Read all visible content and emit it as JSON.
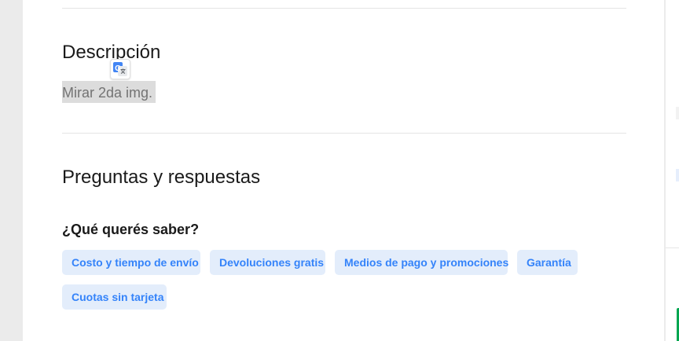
{
  "description": {
    "title": "Descripción",
    "body": "Mirar 2da img.",
    "translate_badge_letter": "G"
  },
  "qa": {
    "title": "Preguntas y respuestas",
    "prompt": "¿Qué querés saber?",
    "quick_questions": [
      "Costo y tiempo de envío",
      "Devoluciones gratis",
      "Medios de pago y promociones",
      "Garantía",
      "Cuotas sin tarjeta"
    ]
  },
  "colors": {
    "accent": "#3483fa",
    "chip_bg": "#e3edfb",
    "highlight_bg": "#dcdcdc",
    "success": "#00a650",
    "page_bg": "#ebebeb"
  },
  "icons": {
    "translate": "google-translate-icon"
  }
}
